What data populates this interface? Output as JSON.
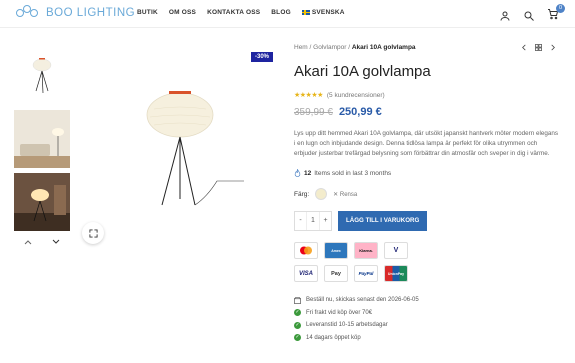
{
  "header": {
    "brand": "BOO LIGHTING",
    "nav": [
      "BUTIK",
      "OM OSS",
      "KONTAKTA OSS",
      "BLOG",
      "SVENSKA"
    ],
    "cart_count": "0",
    "icons": [
      "user-icon",
      "search-icon",
      "cart-icon"
    ]
  },
  "gallery": {
    "sale_badge": "-30%"
  },
  "product": {
    "breadcrumb": [
      "Hem",
      "/",
      "Golvlampor",
      "/",
      "Akari 10A golvlampa"
    ],
    "title": "Akari 10A golvlampa",
    "stars": "★★★★★",
    "rating_text": "(5 kundrecensioner)",
    "old_price": "359,99 €",
    "new_price": "250,99 €",
    "description": "Lys upp ditt hemmed Akari 10A golvlampa, där utsökt japanskt hantverk möter modern elegans i en lugn och inbjudande design. Denna tidlösa lampa är perfekt för olika utrymmen och erbjuder justerbar trefärgad belysning som förbättrar din atmosfär och sveper in dig i värme.",
    "sold_count": "12",
    "sold_text": "Items sold in last 3 months",
    "color_label": "Färg:",
    "clear_label": "✕ Rensa",
    "qty_minus": "-",
    "qty_value": "1",
    "qty_plus": "+",
    "add_to_cart": "LÄGG TILL I VARUKORG",
    "payments": [
      "Mastercard",
      "Amex",
      "Klarna.",
      "V",
      "VISA",
      "Pay",
      "PayPal",
      "UnionPay"
    ],
    "shipping_notes": [
      "Beställ nu, skickas senast den 2026-06-05",
      "Fri frakt vid köp över 70€",
      "Leveranstid 10-15 arbetsdagar",
      "14 dagars öppet köp"
    ]
  },
  "colors": {
    "brand_blue": "#6aa9d8",
    "button_blue": "#2f6ab1",
    "sale_badge": "#1e24a0",
    "star": "#e7b51a"
  }
}
